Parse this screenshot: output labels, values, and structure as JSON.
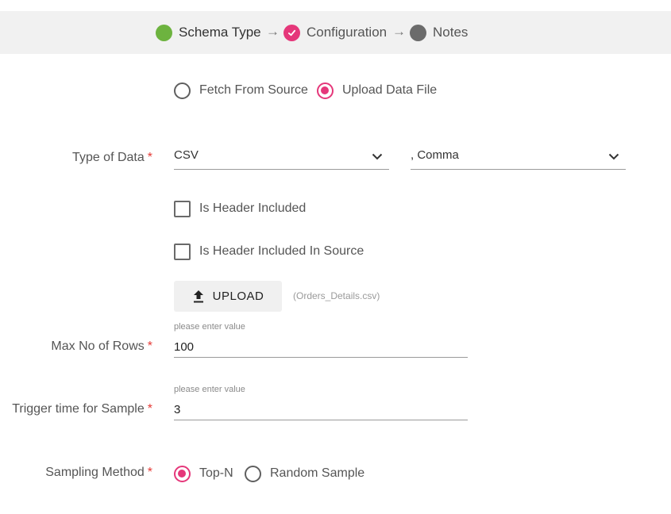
{
  "stepper": {
    "steps": [
      {
        "label": "Schema Type",
        "state": "completed",
        "color": "#6db33f"
      },
      {
        "label": "Configuration",
        "state": "active",
        "color": "#e5377a"
      },
      {
        "label": "Notes",
        "state": "pending",
        "color": "#6b6b6b"
      }
    ],
    "arrow": "→"
  },
  "source": {
    "options": [
      {
        "label": "Fetch From Source",
        "selected": false
      },
      {
        "label": "Upload Data File",
        "selected": true
      }
    ]
  },
  "type_of_data": {
    "label": "Type of Data",
    "required_mark": "*",
    "format_value": "CSV",
    "delimiter_value": ", Comma"
  },
  "checkboxes": [
    {
      "label": "Is Header Included",
      "checked": false
    },
    {
      "label": "Is Header Included In Source",
      "checked": false
    }
  ],
  "upload": {
    "button_label": "UPLOAD",
    "file_name": "(Orders_Details.csv)"
  },
  "max_rows": {
    "label": "Max No of Rows",
    "required_mark": "*",
    "hint": "please enter value",
    "value": "100"
  },
  "trigger_time": {
    "label": "Trigger time for Sample",
    "required_mark": "*",
    "hint": "please enter value",
    "value": "3"
  },
  "sampling": {
    "label": "Sampling Method",
    "required_mark": "*",
    "options": [
      {
        "label": "Top-N",
        "selected": true
      },
      {
        "label": "Random Sample",
        "selected": false
      }
    ]
  },
  "colors": {
    "accent": "#e5377a",
    "success": "#6db33f",
    "required": "#e53935"
  }
}
